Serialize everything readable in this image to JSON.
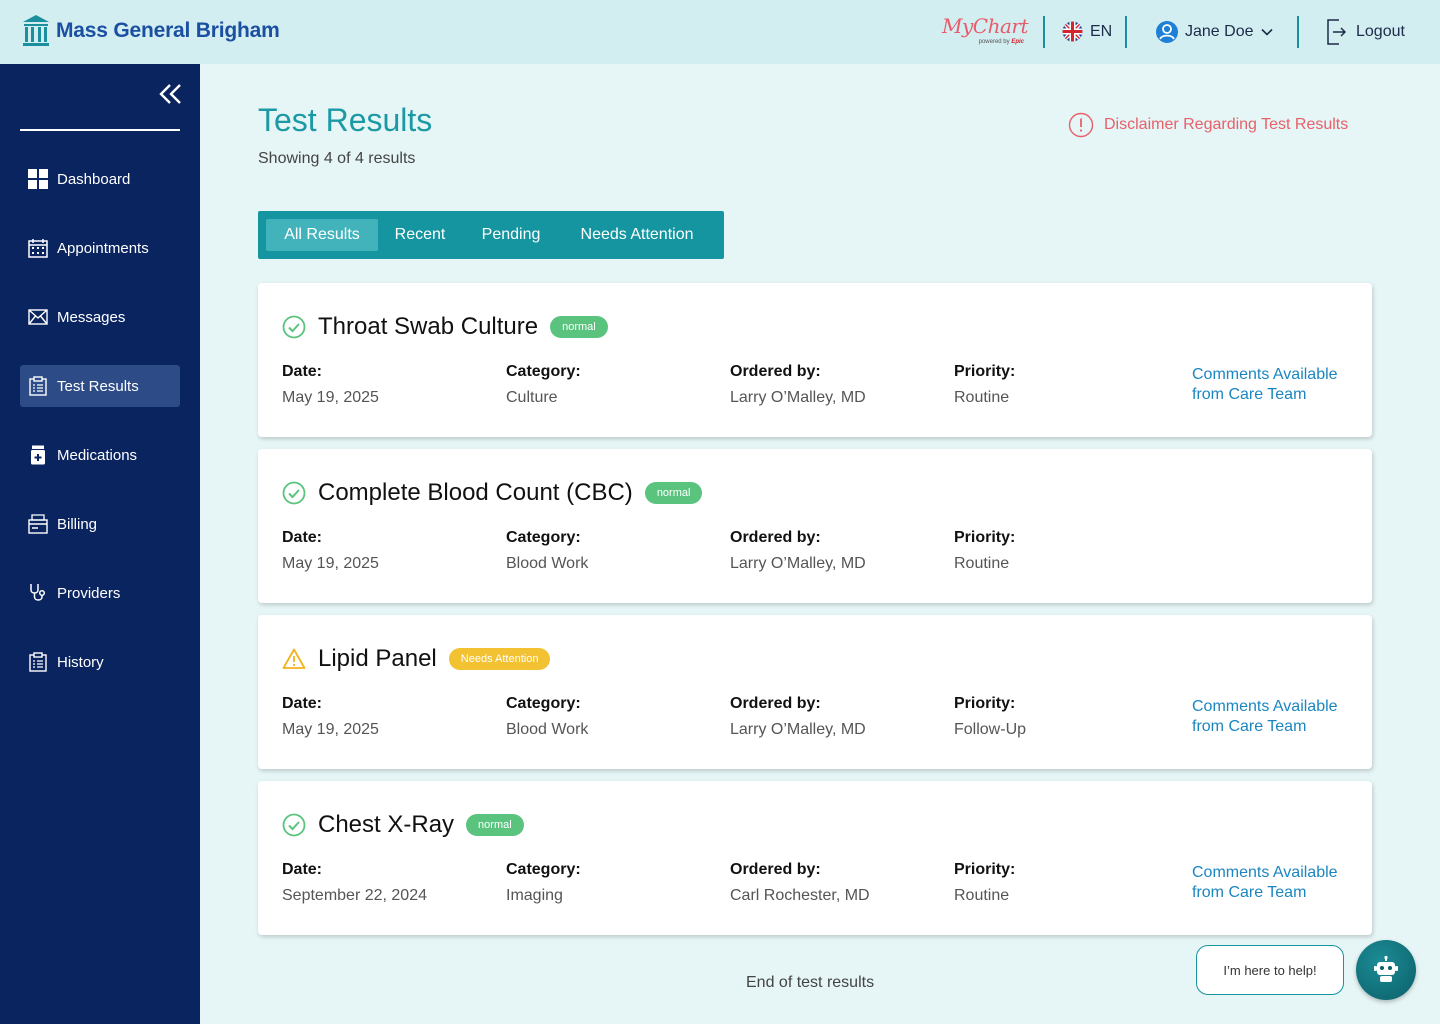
{
  "header": {
    "brand": "Mass General Brigham",
    "mychart": {
      "name": "MyChart",
      "powered_by": "powered by",
      "epic": "Epic"
    },
    "language": "EN",
    "user_name": "Jane Doe",
    "logout_label": "Logout"
  },
  "sidebar": {
    "items": [
      {
        "label": "Dashboard",
        "icon": "dashboard-icon"
      },
      {
        "label": "Appointments",
        "icon": "calendar-icon"
      },
      {
        "label": "Messages",
        "icon": "envelope-icon"
      },
      {
        "label": "Test Results",
        "icon": "clipboard-icon",
        "active": true
      },
      {
        "label": "Medications",
        "icon": "pill-bottle-icon"
      },
      {
        "label": "Billing",
        "icon": "billing-icon"
      },
      {
        "label": "Providers",
        "icon": "stethoscope-icon"
      },
      {
        "label": "History",
        "icon": "history-clipboard-icon"
      }
    ]
  },
  "main": {
    "title": "Test Results",
    "subtitle": "Showing 4 of 4 results",
    "disclaimer": "Disclaimer Regarding Test Results",
    "tabs": [
      {
        "label": "All Results",
        "active": true
      },
      {
        "label": "Recent"
      },
      {
        "label": "Pending"
      },
      {
        "label": "Needs Attention"
      }
    ],
    "field_labels": {
      "date": "Date:",
      "category": "Category:",
      "ordered_by": "Ordered by:",
      "priority": "Priority:"
    },
    "comments_label": "Comments Available from Care Team",
    "results": [
      {
        "title": "Throat Swab Culture",
        "status": "normal",
        "status_icon": "check-circle-icon",
        "date": "May 19, 2025",
        "category": "Culture",
        "ordered_by": "Larry O’Malley, MD",
        "priority": "Routine",
        "has_comments": true
      },
      {
        "title": "Complete Blood Count (CBC)",
        "status": "normal",
        "status_icon": "check-circle-icon",
        "date": "May 19, 2025",
        "category": "Blood Work",
        "ordered_by": "Larry O’Malley, MD",
        "priority": "Routine",
        "has_comments": false
      },
      {
        "title": "Lipid Panel",
        "status": "Needs Attention",
        "status_icon": "warning-triangle-icon",
        "date": "May 19, 2025",
        "category": "Blood Work",
        "ordered_by": "Larry O’Malley, MD",
        "priority": "Follow-Up",
        "has_comments": true
      },
      {
        "title": "Chest X-Ray",
        "status": "normal",
        "status_icon": "check-circle-icon",
        "date": "September 22, 2024",
        "category": "Imaging",
        "ordered_by": "Carl Rochester, MD",
        "priority": "Routine",
        "has_comments": true
      }
    ],
    "end_text": "End of test results"
  },
  "assistant": {
    "bubble": "I’m here to help!",
    "icon": "robot-icon"
  },
  "colors": {
    "teal": "#14959f",
    "navy": "#0a2460",
    "normal_badge": "#5ac47f",
    "attention_badge": "#f2c232",
    "link": "#1b86c0",
    "disclaimer": "#e8606a"
  }
}
